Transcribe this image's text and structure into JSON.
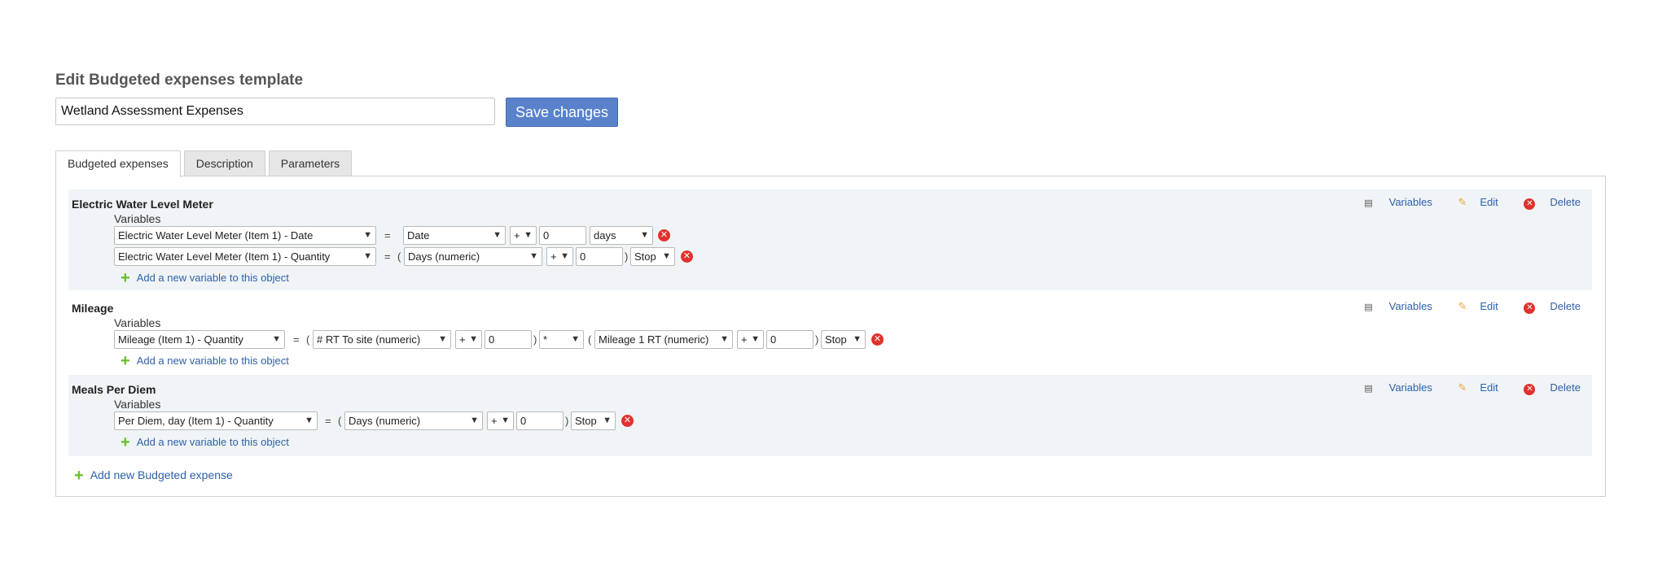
{
  "header": {
    "title": "Edit Budgeted expenses template",
    "template_name": "Wetland Assessment Expenses",
    "save_label": "Save changes"
  },
  "tabs": [
    {
      "label": "Budgeted expenses",
      "active": true
    },
    {
      "label": "Description",
      "active": false
    },
    {
      "label": "Parameters",
      "active": false
    }
  ],
  "labels": {
    "variables": "Variables",
    "add_variable": "Add a new variable to this object",
    "add_expense": "Add new Budgeted expense",
    "action_variables": "Variables",
    "action_edit": "Edit",
    "action_delete": "Delete",
    "equals": "=",
    "open_paren": "(",
    "close_paren": ")"
  },
  "sections": [
    {
      "title": "Electric Water Level Meter",
      "rows": [
        {
          "target": "Electric Water Level Meter (Item 1) - Date",
          "source": "Date",
          "op": "+",
          "value": "0",
          "unit": "days"
        },
        {
          "target": "Electric Water Level Meter (Item 1) - Quantity",
          "source": "Days (numeric)",
          "op": "+",
          "value": "0",
          "end": "Stop"
        }
      ]
    },
    {
      "title": "Mileage",
      "rows": [
        {
          "target": "Mileage (Item 1) - Quantity",
          "source": "# RT To site (numeric)",
          "op": "+",
          "value": "0",
          "mul": "*",
          "source2": "Mileage 1 RT (numeric)",
          "op2": "+",
          "value2": "0",
          "end": "Stop"
        }
      ]
    },
    {
      "title": "Meals Per Diem",
      "rows": [
        {
          "target": "Per Diem, day (Item 1) - Quantity",
          "source": "Days (numeric)",
          "op": "+",
          "value": "0",
          "end": "Stop"
        }
      ]
    }
  ],
  "colors": {
    "accent": "#5a82cb",
    "link": "#2f61a8",
    "add_icon": "#6abd2c",
    "delete": "#e0322e",
    "section_bg": "#f0f4f6"
  }
}
